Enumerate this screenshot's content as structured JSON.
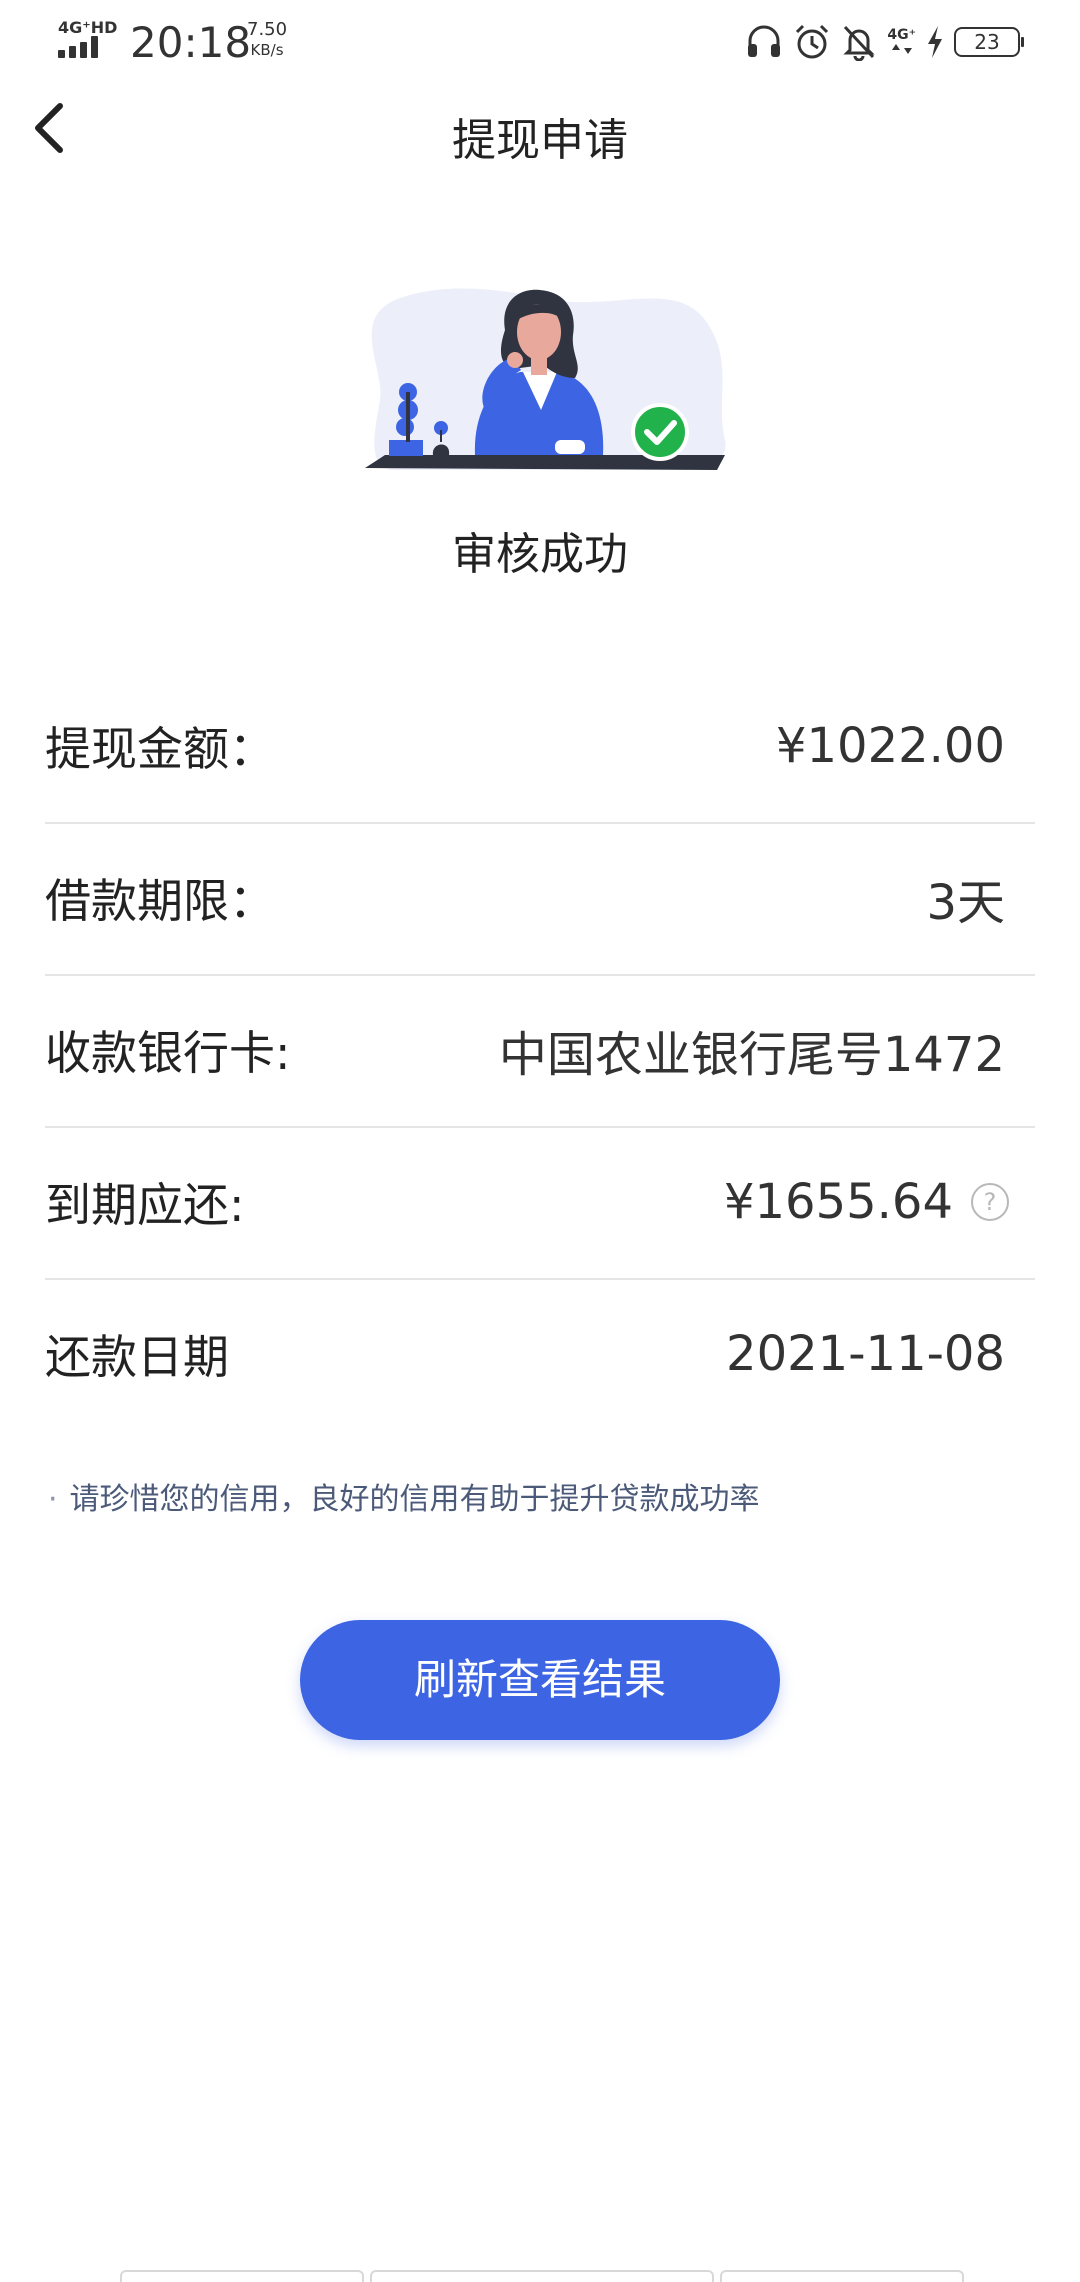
{
  "status_bar": {
    "network": "4G⁺HD",
    "time": "20:18",
    "speed_value": "7.50",
    "speed_unit": "KB/s",
    "network2": "4G⁺",
    "battery": "23",
    "icons": [
      "headphones-icon",
      "alarm-icon",
      "bell-off-icon",
      "4g-icon",
      "charging-icon",
      "battery-icon"
    ]
  },
  "nav": {
    "title": "提现申请",
    "back_icon": "chevron-left-icon"
  },
  "status": {
    "text": "审核成功",
    "accent_color": "#22b24c"
  },
  "details": [
    {
      "label": "提现金额：",
      "value": "¥1022.00"
    },
    {
      "label": "借款期限：",
      "value": "3天"
    },
    {
      "label": "收款银行卡:",
      "value": "中国农业银行尾号1472"
    },
    {
      "label": "到期应还:",
      "value": "¥1655.64",
      "help": "?"
    },
    {
      "label": "还款日期",
      "value": "2021-11-08"
    }
  ],
  "tip": {
    "bullet": "·",
    "text": "请珍惜您的信用，良好的信用有助于提升贷款成功率"
  },
  "button": {
    "label": "刷新查看结果",
    "color": "#3d65e3"
  }
}
